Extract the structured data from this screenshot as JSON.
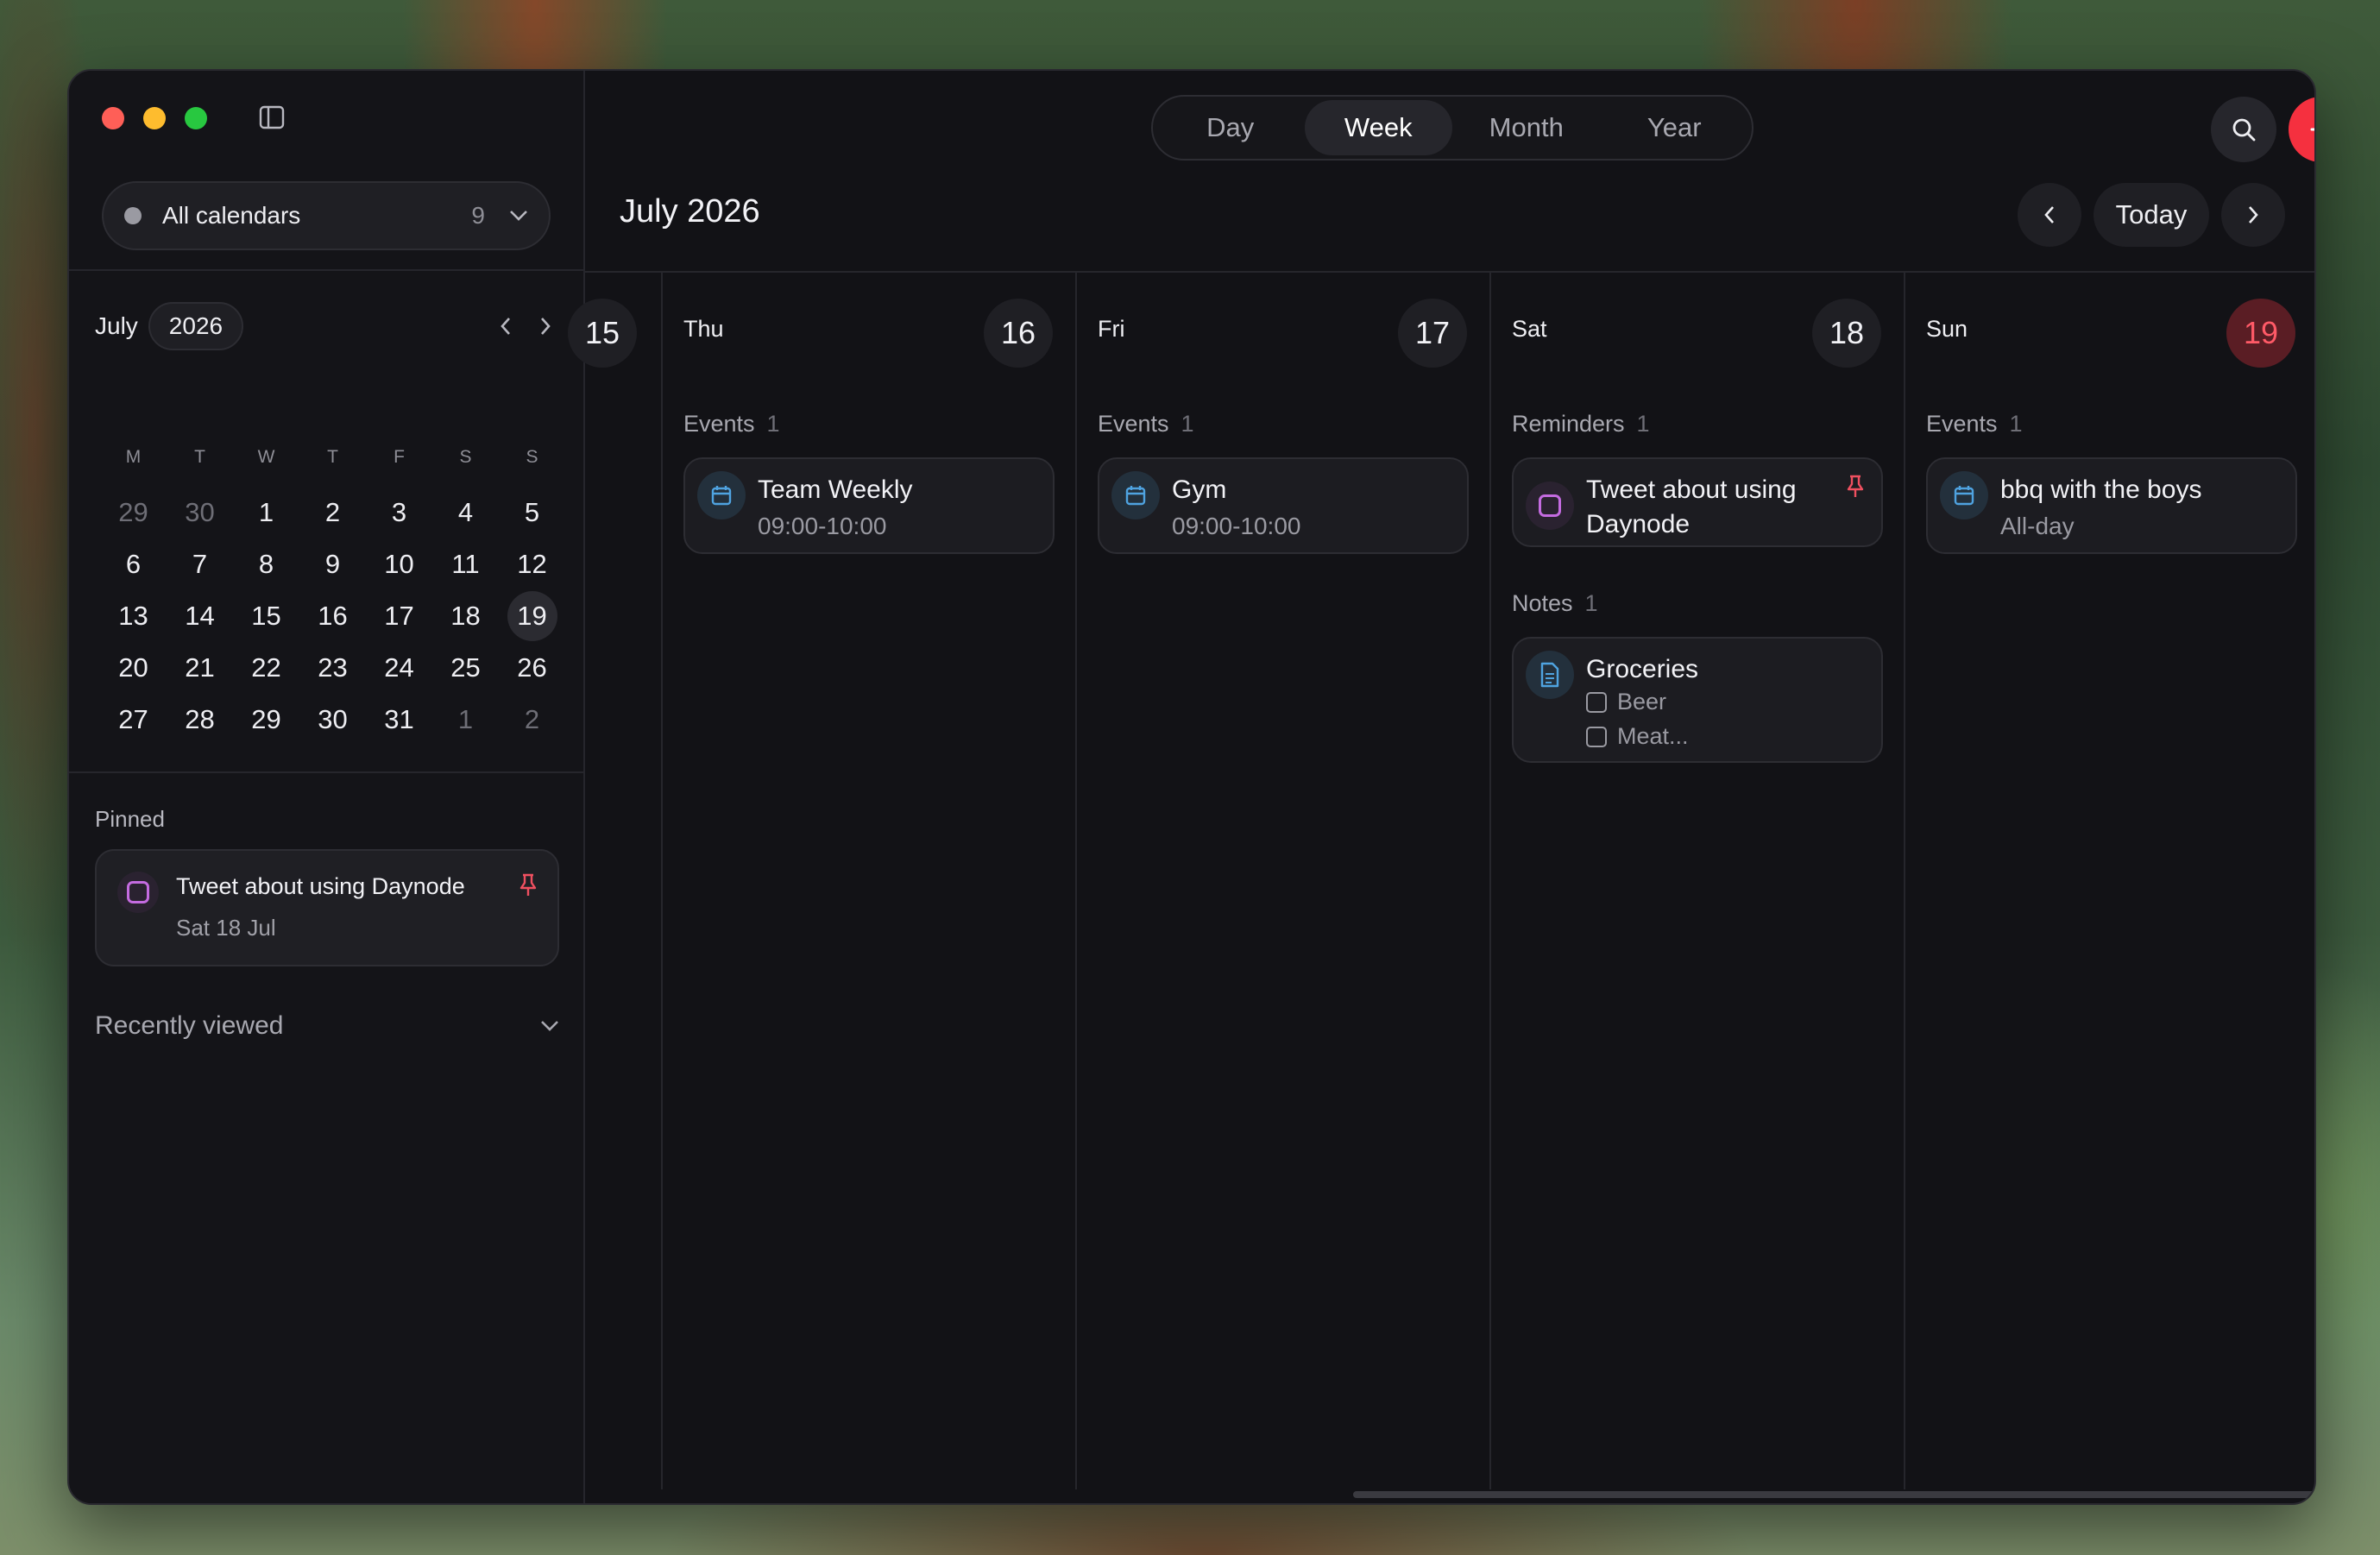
{
  "sidebar": {
    "calendar_selector": {
      "label": "All calendars",
      "count": "9"
    },
    "mini_calendar": {
      "month": "July",
      "year": "2026",
      "weekdays": [
        "M",
        "T",
        "W",
        "T",
        "F",
        "S",
        "S"
      ],
      "weeks": [
        [
          "29",
          "30",
          "1",
          "2",
          "3",
          "4",
          "5"
        ],
        [
          "6",
          "7",
          "8",
          "9",
          "10",
          "11",
          "12"
        ],
        [
          "13",
          "14",
          "15",
          "16",
          "17",
          "18",
          "19"
        ],
        [
          "20",
          "21",
          "22",
          "23",
          "24",
          "25",
          "26"
        ],
        [
          "27",
          "28",
          "29",
          "30",
          "31",
          "1",
          "2"
        ]
      ],
      "today": "19"
    },
    "pinned": {
      "title": "Pinned",
      "item": {
        "title": "Tweet about using Daynode",
        "date": "Sat 18 Jul"
      }
    },
    "recently_viewed": "Recently viewed"
  },
  "toolbar": {
    "views": [
      "Day",
      "Week",
      "Month",
      "Year"
    ],
    "active_view": "Week",
    "title": "July 2026",
    "today_label": "Today"
  },
  "week": {
    "partial_day": "15",
    "columns": [
      {
        "day": "Thu",
        "date": "16",
        "sections": [
          {
            "label": "Events",
            "count": "1",
            "items": [
              {
                "title": "Team Weekly",
                "time": "09:00-10:00"
              }
            ]
          }
        ]
      },
      {
        "day": "Fri",
        "date": "17",
        "sections": [
          {
            "label": "Events",
            "count": "1",
            "items": [
              {
                "title": "Gym",
                "time": "09:00-10:00"
              }
            ]
          }
        ]
      },
      {
        "day": "Sat",
        "date": "18",
        "sections": [
          {
            "label": "Reminders",
            "count": "1",
            "items": [
              {
                "title": "Tweet about using Daynode"
              }
            ]
          },
          {
            "label": "Notes",
            "count": "1",
            "items": [
              {
                "title": "Groceries",
                "checklist": [
                  "Beer",
                  "Meat..."
                ]
              }
            ]
          }
        ]
      },
      {
        "day": "Sun",
        "date": "19",
        "sections": [
          {
            "label": "Events",
            "count": "1",
            "items": [
              {
                "title": "bbq with the boys",
                "time": "All-day"
              }
            ]
          }
        ]
      }
    ]
  },
  "colors": {
    "accent_red": "#f5303f",
    "reminder_purple": "#c46be0",
    "event_blue": "#4fa3e0",
    "today_red": "#ff5a67"
  }
}
